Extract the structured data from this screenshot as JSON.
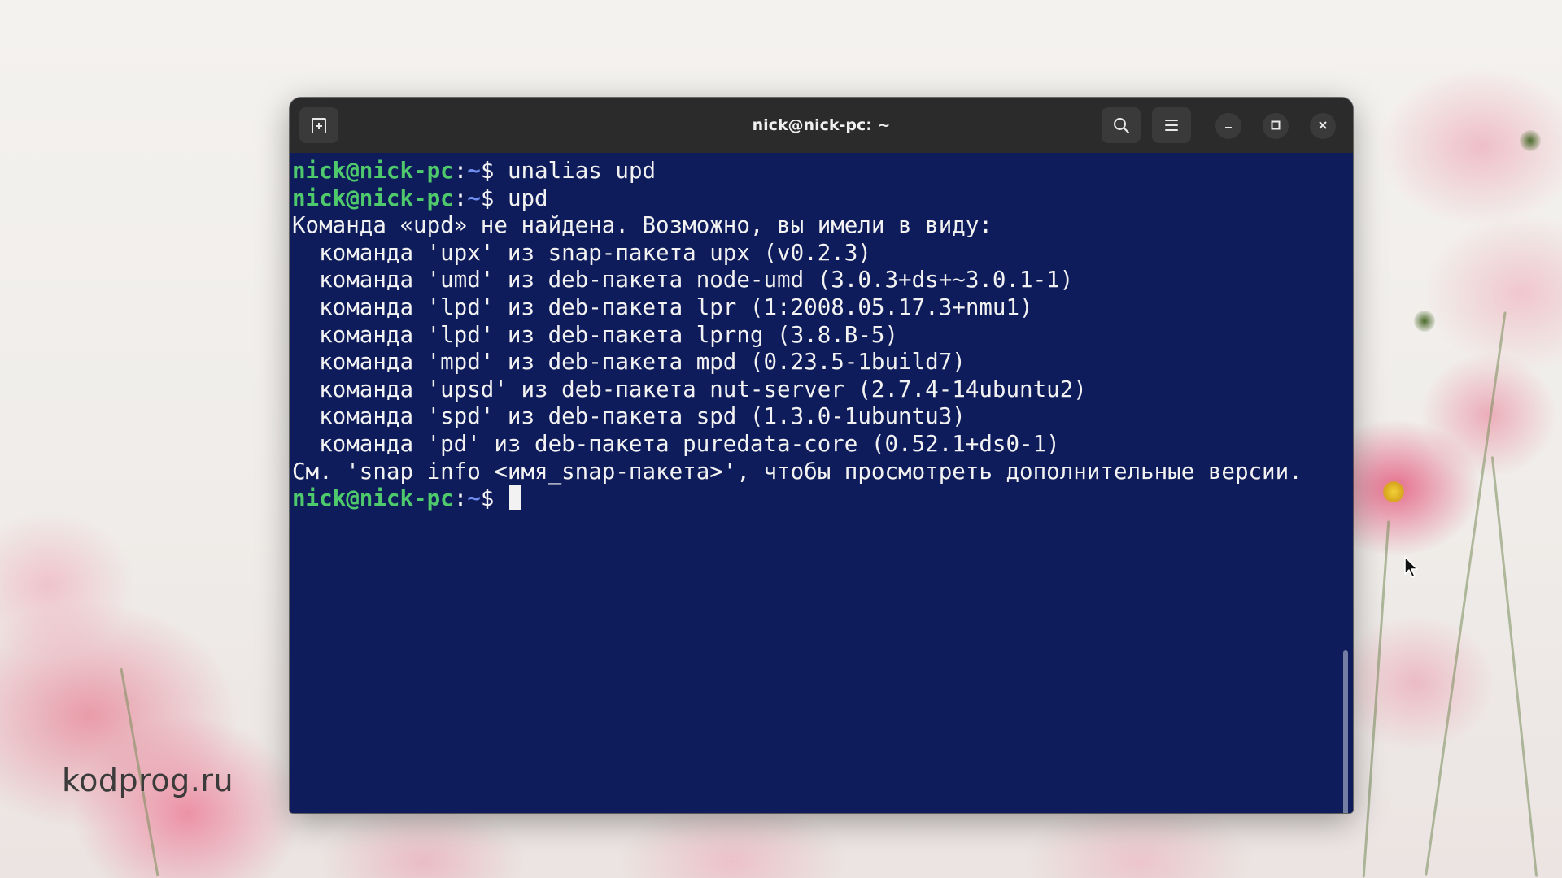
{
  "watermark": "kodprog.ru",
  "window": {
    "title": "nick@nick-pc: ~"
  },
  "prompt": {
    "user": "nick@nick-pc",
    "sep": ":",
    "path": "~",
    "symbol": "$ "
  },
  "commands": [
    "unalias upd",
    "upd"
  ],
  "output": [
    "Команда «upd» не найдена. Возможно, вы имели в виду:",
    "  команда 'upx' из snap-пакета upx (v0.2.3)",
    "  команда 'umd' из deb-пакета node-umd (3.0.3+ds+~3.0.1-1)",
    "  команда 'lpd' из deb-пакета lpr (1:2008.05.17.3+nmu1)",
    "  команда 'lpd' из deb-пакета lprng (3.8.B-5)",
    "  команда 'mpd' из deb-пакета mpd (0.23.5-1build7)",
    "  команда 'upsd' из deb-пакета nut-server (2.7.4-14ubuntu2)",
    "  команда 'spd' из deb-пакета spd (1.3.0-1ubuntu3)",
    "  команда 'pd' из deb-пакета puredata-core (0.52.1+ds0-1)",
    "См. 'snap info <имя_snap-пакета>', чтобы просмотреть дополнительные версии."
  ],
  "colors": {
    "terminal_bg": "#0f1c5b",
    "titlebar_bg": "#2b2b2b",
    "prompt_user": "#4ec96b",
    "prompt_path": "#6f8ff0",
    "text": "#f2f2f2"
  },
  "icons": {
    "new_tab": "new-tab-icon",
    "search": "search-icon",
    "menu": "hamburger-menu-icon",
    "minimize": "minimize-icon",
    "maximize": "maximize-icon",
    "close": "close-icon"
  }
}
